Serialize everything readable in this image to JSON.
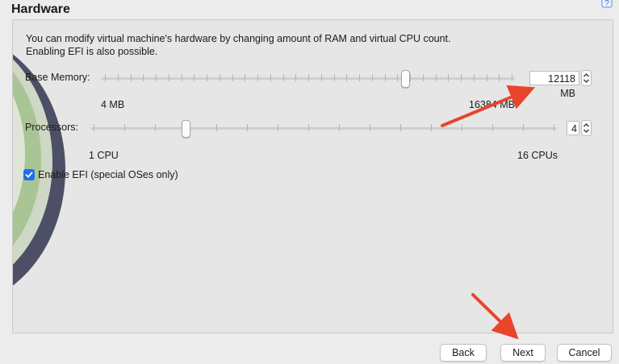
{
  "header": {
    "title": "Hardware"
  },
  "description": {
    "line1": "You can modify virtual machine's hardware by changing amount of RAM and virtual CPU count.",
    "line2": "Enabling EFI is also possible."
  },
  "memory": {
    "label": "Base Memory:",
    "value": "12118 MB",
    "min_label": "4 MB",
    "max_label": "16384 MB",
    "min": 4,
    "max": 16384,
    "current": 12118
  },
  "processors": {
    "label": "Processors:",
    "value": "4",
    "min_label": "1 CPU",
    "max_label": "16 CPUs",
    "min": 1,
    "max": 16,
    "current": 4
  },
  "efi": {
    "label": "Enable EFI (special OSes only)",
    "checked": true
  },
  "buttons": {
    "back": "Back",
    "next": "Next",
    "cancel": "Cancel"
  },
  "colors": {
    "annotation_arrow": "#e8452c",
    "checkbox": "#1f6feb"
  }
}
